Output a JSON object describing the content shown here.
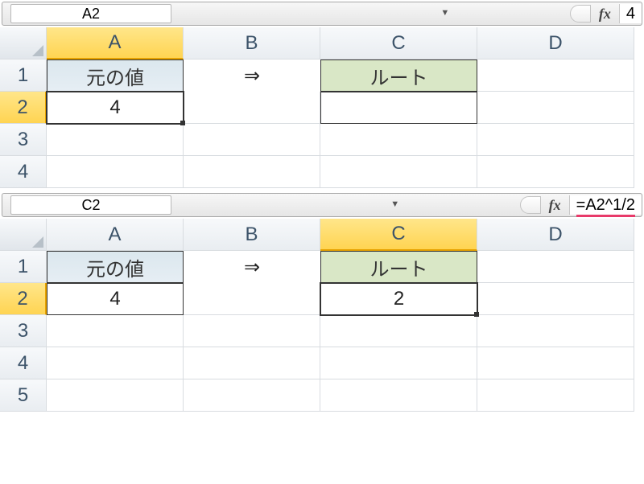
{
  "part1": {
    "name_box": "A2",
    "fx": "fx",
    "formula": "4",
    "columns": [
      "A",
      "B",
      "C",
      "D"
    ],
    "rows": [
      "1",
      "2",
      "3",
      "4"
    ],
    "a1": "元の値",
    "a2": "4",
    "b1": "⇒",
    "c1": "ルート",
    "c2": ""
  },
  "part2": {
    "name_box": "C2",
    "fx": "fx",
    "formula": "=A2^1/2",
    "columns": [
      "A",
      "B",
      "C",
      "D"
    ],
    "rows": [
      "1",
      "2",
      "3",
      "4",
      "5"
    ],
    "a1": "元の値",
    "a2": "4",
    "b1": "⇒",
    "c1": "ルート",
    "c2": "2"
  }
}
